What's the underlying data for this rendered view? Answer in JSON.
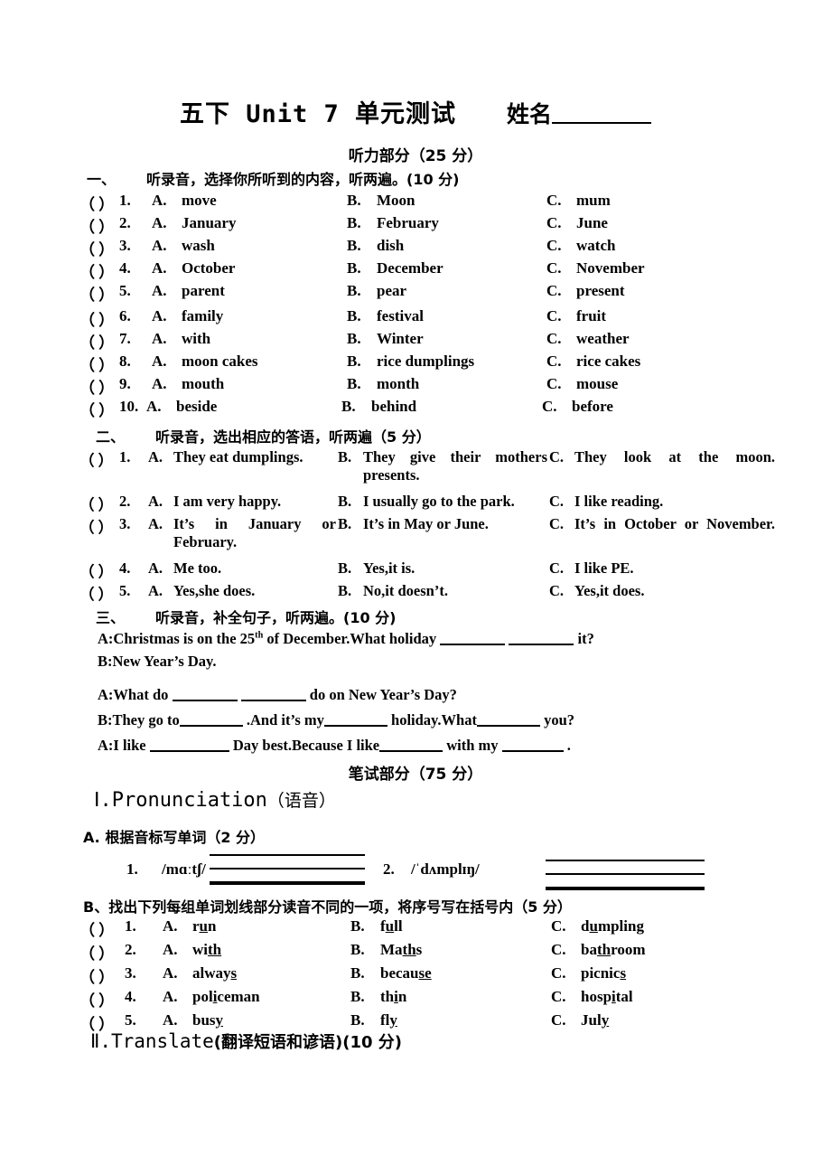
{
  "header": {
    "title": "五下 Unit 7 单元测试",
    "name_label": "姓名"
  },
  "listening": {
    "section_title": "听力部分（25 分）",
    "part1": {
      "index": "一、",
      "instruction": "听录音，选择你所听到的内容，听两遍。(10 分)",
      "rows": [
        {
          "num": "1.",
          "a": "move",
          "b": "Moon",
          "c": "mum"
        },
        {
          "num": "2.",
          "a": "January",
          "b": "February",
          "c": "June"
        },
        {
          "num": "3.",
          "a": "wash",
          "b": "dish",
          "c": "watch"
        },
        {
          "num": "4.",
          "a": "October",
          "b": "December",
          "c": "November"
        },
        {
          "num": "5.",
          "a": "parent",
          "b": "pear",
          "c": "present"
        },
        {
          "num": "6.",
          "a": "family",
          "b": "festival",
          "c": "fruit"
        },
        {
          "num": "7.",
          "a": "with",
          "b": "Winter",
          "c": "weather"
        },
        {
          "num": "8.",
          "a": "moon cakes",
          "b": "rice dumplings",
          "c": "rice cakes"
        },
        {
          "num": "9.",
          "a": "mouth",
          "b": "month",
          "c": "mouse"
        },
        {
          "num": "10.",
          "a": "beside",
          "b": "behind",
          "c": "before"
        }
      ],
      "label_a": "A.",
      "label_b": "B.",
      "label_c": "C.",
      "paren": "（    ）"
    },
    "part2": {
      "index": "二、",
      "instruction": "听录音，选出相应的答语，听两遍（5 分）",
      "rows": [
        {
          "num": "1.",
          "a": "They eat dumplings.",
          "b": "They give their mothers presents.",
          "c": "They look at the moon."
        },
        {
          "num": "2.",
          "a": "I am very happy.",
          "b": "I usually go to the park.",
          "c": "I like reading."
        },
        {
          "num": "3.",
          "a": "It’s in January or February.",
          "b": "It’s in May or June.",
          "c": "It’s in October or November."
        },
        {
          "num": "4.",
          "a": "Me too.",
          "b": "Yes,it is.",
          "c": "I like PE."
        },
        {
          "num": "5.",
          "a": "Yes,she does.",
          "b": "No,it doesn’t.",
          "c": "Yes,it does."
        }
      ]
    },
    "part3": {
      "index": "三、",
      "instruction": "听录音，补全句子，听两遍。(10 分)",
      "line1_a": "A:Christmas is on the 25",
      "line1_sup": "th",
      "line1_b": " of December.What holiday",
      "line1_c": "it?",
      "line2": "B:New Year’s Day.",
      "line3_a": "A:What do",
      "line3_b": "do on New Year’s Day?",
      "line4_a": "B:They go to",
      "line4_b": ".And it’s my",
      "line4_c": "holiday.What",
      "line4_d": "you?",
      "line5_a": "A:I like",
      "line5_b": "Day best.Because I like",
      "line5_c": "with my",
      "line5_d": "."
    }
  },
  "written": {
    "section_title": "笔试部分（75 分）",
    "part1": {
      "roman": "Ⅰ.",
      "heading_en": "Pronunciation",
      "heading_zh": "（语音）",
      "a_title": "A. 根据音标写单词（2 分）",
      "phonetics": [
        {
          "num": "1.",
          "symbol": "/mɑːtʃ/"
        },
        {
          "num": "2.",
          "symbol": "/ˈdʌmplɪŋ/"
        }
      ],
      "b_title": "B、找出下列每组单词划线部分读音不同的一项，将序号写在括号内（5 分）",
      "rows": [
        {
          "num": "1.",
          "a": [
            "r",
            "u",
            "n"
          ],
          "b": [
            "f",
            "u",
            "ll"
          ],
          "c": [
            "d",
            "u",
            "mpling"
          ]
        },
        {
          "num": "2.",
          "a": [
            "wi",
            "th",
            ""
          ],
          "b": [
            "Ma",
            "th",
            "s"
          ],
          "c": [
            "ba",
            "th",
            "room"
          ]
        },
        {
          "num": "3.",
          "a": [
            "alway",
            "s",
            ""
          ],
          "b": [
            "becau",
            "se",
            ""
          ],
          "c": [
            "picnic",
            "s",
            ""
          ]
        },
        {
          "num": "4.",
          "a": [
            "pol",
            "i",
            "ceman"
          ],
          "b": [
            "th",
            "i",
            "n"
          ],
          "c": [
            "hosp",
            "i",
            "tal"
          ]
        },
        {
          "num": "5.",
          "a": [
            "bus",
            "y",
            ""
          ],
          "b": [
            "fl",
            "y",
            ""
          ],
          "c": [
            "Jul",
            "y",
            ""
          ]
        }
      ]
    },
    "part2": {
      "roman": "Ⅱ.",
      "heading_en": "Translate",
      "heading_zh": "(翻译短语和谚语)",
      "score": "(10 分)"
    }
  }
}
